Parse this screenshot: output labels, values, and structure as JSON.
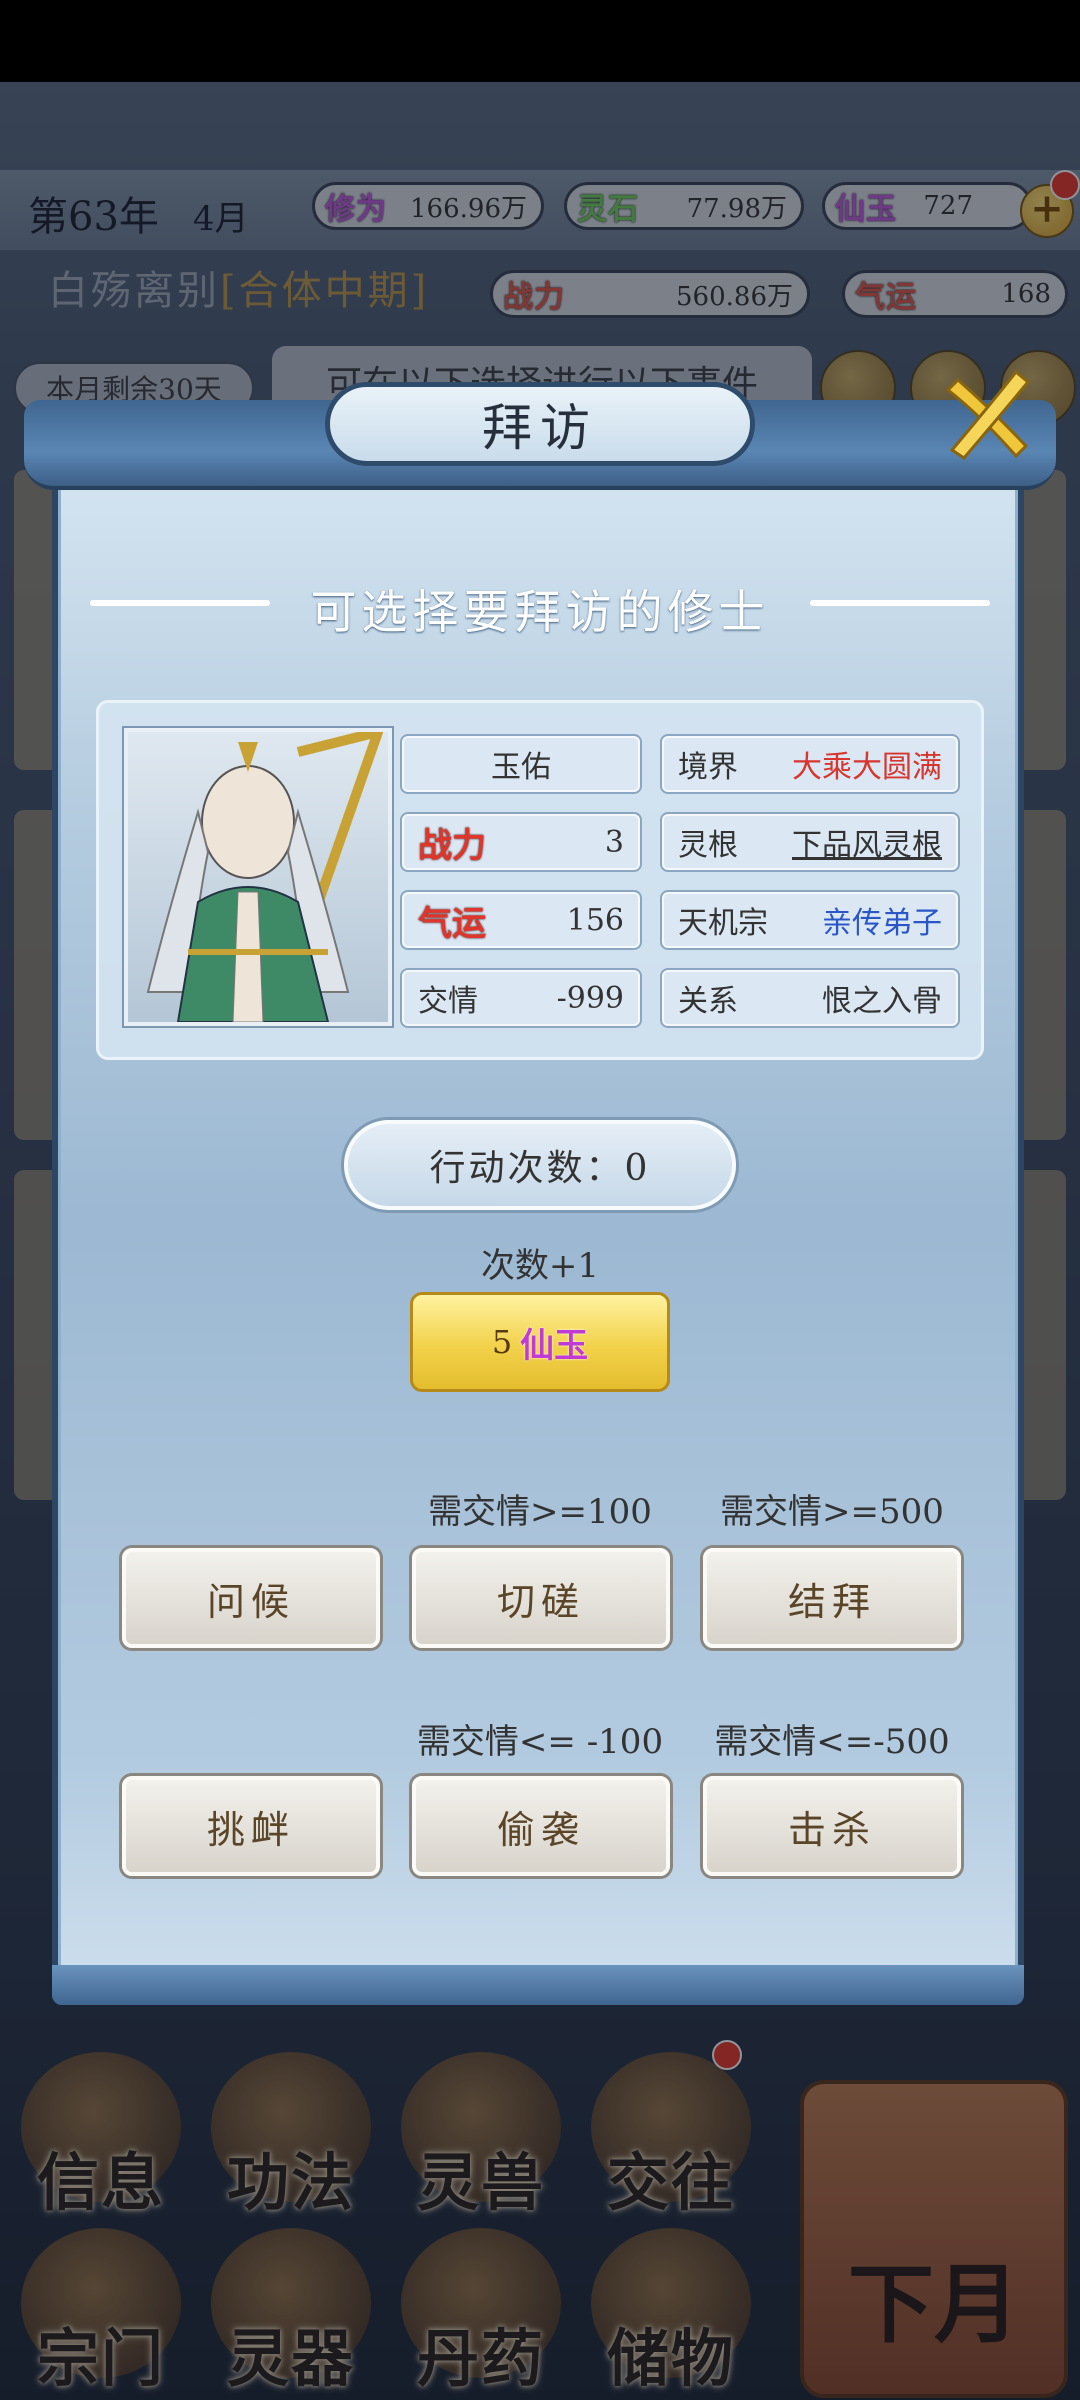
{
  "hud": {
    "year": "第63年",
    "month": "4月",
    "cultivation_label": "修为",
    "cultivation_value": "166.96万",
    "spirit_stone_label": "灵石",
    "spirit_stone_value": "77.98万",
    "jade_label": "仙玉",
    "jade_value": "727",
    "jade_plus": "+",
    "player_name": "白殇离别",
    "player_realm": "[合体中期]",
    "power_label": "战力",
    "power_value": "560.86万",
    "luck_label": "气运",
    "luck_value": "168",
    "days_left": "本月剩余30天",
    "event_hint": "可在以下选择进行以下事件"
  },
  "dialog": {
    "title": "拜访",
    "subtitle": "可选择要拜访的修士",
    "cultivator": {
      "name": "玉佑",
      "power_label": "战力",
      "power": "3",
      "luck_label": "气运",
      "luck": "156",
      "friendship_label": "交情",
      "friendship": "-999",
      "realm_label": "境界",
      "realm": "大乘大圆满",
      "root_label": "灵根",
      "root": "下品风灵根",
      "sect_label": "天机宗",
      "sect_rank": "亲传弟子",
      "relation_label": "关系",
      "relation": "恨之入骨"
    },
    "action_count_label": "行动次数：0",
    "plus_label": "次数+1",
    "cost_amount": "5",
    "cost_currency": "仙玉",
    "friendly_actions": [
      {
        "req": "",
        "label": "问候"
      },
      {
        "req": "需交情>=100",
        "label": "切磋"
      },
      {
        "req": "需交情>=500",
        "label": "结拜"
      }
    ],
    "hostile_actions": [
      {
        "req": "",
        "label": "挑衅"
      },
      {
        "req": "需交情<= -100",
        "label": "偷袭"
      },
      {
        "req": "需交情<=-500",
        "label": "击杀"
      }
    ]
  },
  "menu": {
    "row1": [
      "信息",
      "功法",
      "灵兽",
      "交往"
    ],
    "row2": [
      "宗门",
      "灵器",
      "丹药",
      "储物"
    ],
    "next_month": "下月"
  },
  "colors": {
    "jade_purple": "#c25be0",
    "stone_green": "#6fd25d",
    "stat_red": "#e0352a",
    "realm_red": "#d7352e",
    "rank_blue": "#2a56c8",
    "cost_yellow": "#f2d24a"
  }
}
